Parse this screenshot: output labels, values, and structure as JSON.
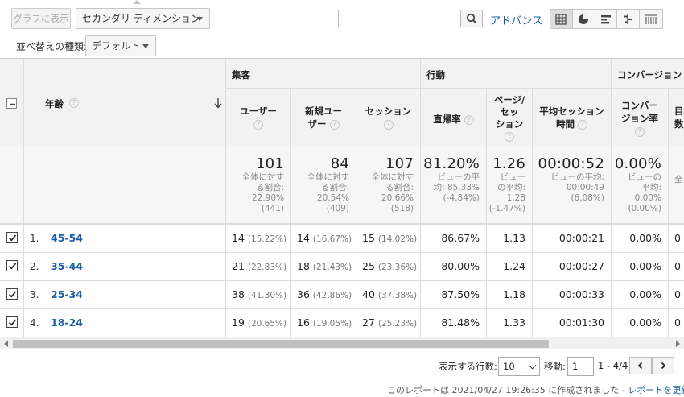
{
  "toolbar": {
    "graph_button": "グラフに表示",
    "secondary_dimension": "セカンダリ ディメンション",
    "sort_label": "並べ替えの種類:",
    "sort_value": "デフォルト",
    "search_value": "",
    "advanced_link": "アドバンス"
  },
  "table": {
    "dimension_header": "年齢",
    "groups": [
      "集客",
      "行動",
      "コンバージョン"
    ],
    "columns": [
      {
        "l1": "ユーザー",
        "l2": ""
      },
      {
        "l1": "新規ユー",
        "l2": "ザー"
      },
      {
        "l1": "セッション",
        "l2": ""
      },
      {
        "l1": "直帰率",
        "l2": ""
      },
      {
        "l1": "ページ/",
        "l2": "セッ",
        "l3": "ション"
      },
      {
        "l1": "平均セッション",
        "l2": "時間"
      },
      {
        "l1": "コンバー",
        "l2": "ジョン率"
      },
      {
        "l1": "目標",
        "l2": "数"
      }
    ],
    "totals": [
      {
        "value": "101",
        "s1": "全体に対す",
        "s2": "る割合:",
        "s3": "22.90%",
        "s4": "(441)"
      },
      {
        "value": "84",
        "s1": "全体に対す",
        "s2": "る割合:",
        "s3": "20.54%",
        "s4": "(409)"
      },
      {
        "value": "107",
        "s1": "全体に対す",
        "s2": "る割合:",
        "s3": "20.66%",
        "s4": "(518)"
      },
      {
        "value": "81.20%",
        "s1": "ビューの平",
        "s2": "均: 85.33%",
        "s3": "(-4.84%)",
        "s4": ""
      },
      {
        "value": "1.26",
        "s1": "ビュー",
        "s2": "の平均:",
        "s3": "1.28",
        "s4": "(-1.47%)"
      },
      {
        "value": "00:00:52",
        "s1": "ビューの平均:",
        "s2": "00:00:49",
        "s3": "(6.08%)",
        "s4": ""
      },
      {
        "value": "0.00%",
        "s1": "ビューの",
        "s2": "平均:",
        "s3": "0.00%",
        "s4": "(0.00%)"
      },
      {
        "value": "",
        "s1": "全",
        "s2": "",
        "s3": "",
        "s4": ""
      }
    ],
    "rows": [
      {
        "idx": "1.",
        "age": "45-54",
        "users": "14",
        "users_pct": "(15.22%)",
        "new": "14",
        "new_pct": "(16.67%)",
        "sessions": "15",
        "sessions_pct": "(14.02%)",
        "bounce": "86.67%",
        "pps": "1.13",
        "dur": "00:00:21",
        "conv": "0.00%",
        "goal": "0"
      },
      {
        "idx": "2.",
        "age": "35-44",
        "users": "21",
        "users_pct": "(22.83%)",
        "new": "18",
        "new_pct": "(21.43%)",
        "sessions": "25",
        "sessions_pct": "(23.36%)",
        "bounce": "80.00%",
        "pps": "1.24",
        "dur": "00:00:27",
        "conv": "0.00%",
        "goal": "0"
      },
      {
        "idx": "3.",
        "age": "25-34",
        "users": "38",
        "users_pct": "(41.30%)",
        "new": "36",
        "new_pct": "(42.86%)",
        "sessions": "40",
        "sessions_pct": "(37.38%)",
        "bounce": "87.50%",
        "pps": "1.18",
        "dur": "00:00:33",
        "conv": "0.00%",
        "goal": "0"
      },
      {
        "idx": "4.",
        "age": "18-24",
        "users": "19",
        "users_pct": "(20.65%)",
        "new": "16",
        "new_pct": "(19.05%)",
        "sessions": "27",
        "sessions_pct": "(25.23%)",
        "bounce": "81.48%",
        "pps": "1.33",
        "dur": "00:01:30",
        "conv": "0.00%",
        "goal": "0"
      }
    ]
  },
  "footer": {
    "rows_label": "表示する行数:",
    "rows_value": "10",
    "goto_label": "移動:",
    "goto_value": "1",
    "range": "1 - 4/4",
    "report_note": "このレポートは 2021/04/27 19:26:35 に作成されました - ",
    "refresh_link": "レポートを更新"
  },
  "colors": {
    "link": "#1a5ea8",
    "header_bg": "#f2f2f2"
  }
}
